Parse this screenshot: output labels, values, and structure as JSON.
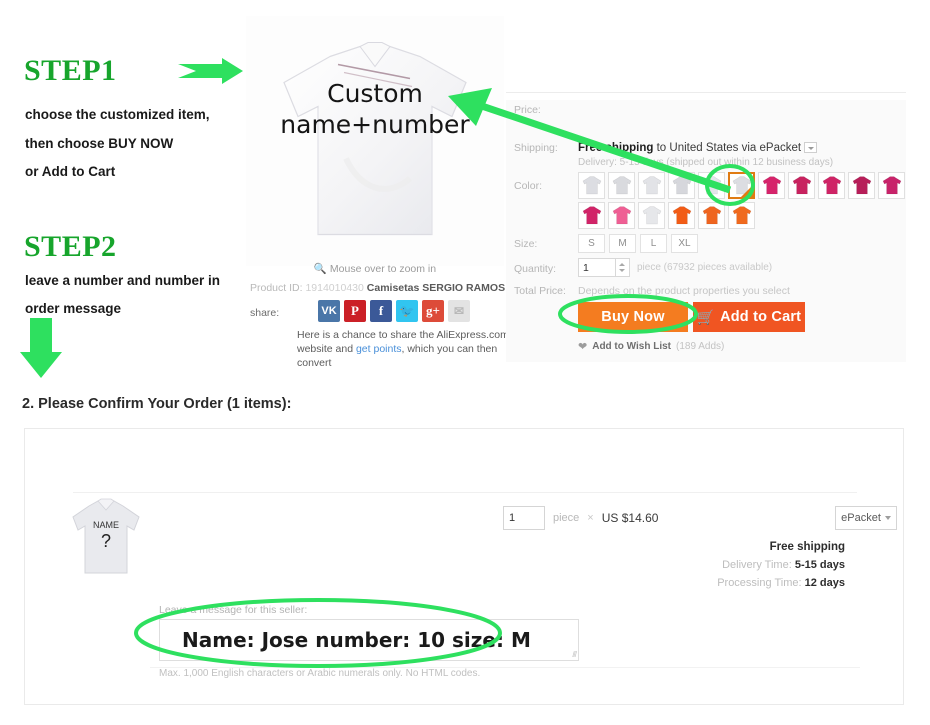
{
  "instructions": {
    "step1": {
      "title": "STEP1",
      "lines": [
        "choose the customized item,",
        "then choose BUY NOW",
        "or Add to Cart"
      ]
    },
    "step2": {
      "title": "STEP2",
      "lines": [
        "leave a number and number in",
        "order message"
      ]
    }
  },
  "product_image": {
    "overlay_line1": "Custom",
    "overlay_line2": "name+number",
    "zoom_hint": "Mouse over to zoom in",
    "zoom_icon": "search-icon"
  },
  "product_meta": {
    "id_label": "Product ID:",
    "id_value": "1914010430",
    "title": "Camisetas SERGIO RAMOS Soccer ...",
    "share_label": "share:",
    "share_icons": [
      {
        "name": "vk-icon",
        "glyph": "VK",
        "color": "#4a76a8"
      },
      {
        "name": "pinterest-icon",
        "glyph": "P",
        "color": "#cb2027"
      },
      {
        "name": "facebook-icon",
        "glyph": "f",
        "color": "#3b5998"
      },
      {
        "name": "twitter-icon",
        "glyph": "✉",
        "color": "#31c5f0"
      },
      {
        "name": "google-plus-icon",
        "glyph": "g+",
        "color": "#dd4b39"
      },
      {
        "name": "email-icon",
        "glyph": "✉",
        "color": "#e3e3e3"
      }
    ],
    "share_desc_a": "Here is a chance to share the AliExpress.com",
    "share_desc_b1": "website and ",
    "share_desc_link": "get points",
    "share_desc_b2": ", which you can then convert"
  },
  "detail": {
    "price_label": "Price:",
    "shipping_label": "Shipping:",
    "shipping_free": "Free shipping",
    "shipping_rest": " to United States via ePacket",
    "shipping_sub": "Delivery: 5-15 days (shipped out within 12 business days)",
    "color_label": "Color:",
    "colors": [
      {
        "name": "white-11",
        "hex": "#dcdde2",
        "selected": false
      },
      {
        "name": "white-10",
        "hex": "#d9dade",
        "selected": false
      },
      {
        "name": "white-7",
        "hex": "#e2e3e7",
        "selected": false
      },
      {
        "name": "white-8",
        "hex": "#d6d7dc",
        "selected": false
      },
      {
        "name": "white-plain",
        "hex": "#e4e5ea",
        "selected": false
      },
      {
        "name": "white-selected",
        "hex": "#dcdde2",
        "selected": true
      },
      {
        "name": "magenta-11",
        "hex": "#d6246b",
        "selected": false
      },
      {
        "name": "magenta-7",
        "hex": "#c8225f",
        "selected": false
      },
      {
        "name": "magenta-10",
        "hex": "#cf2466",
        "selected": false
      },
      {
        "name": "magenta-dark",
        "hex": "#b71e59",
        "selected": false
      },
      {
        "name": "magenta-plain",
        "hex": "#c8236a",
        "selected": false
      },
      {
        "name": "magenta-alt",
        "hex": "#d12468",
        "selected": false
      },
      {
        "name": "pink-light",
        "hex": "#ef5f94",
        "selected": false
      },
      {
        "name": "white-21",
        "hex": "#e6e7ea",
        "selected": false
      },
      {
        "name": "orange-1",
        "hex": "#f25c16",
        "selected": false
      },
      {
        "name": "orange-2",
        "hex": "#ef6520",
        "selected": false
      },
      {
        "name": "orange-3",
        "hex": "#f06a1e",
        "selected": false
      }
    ],
    "size_label": "Size:",
    "sizes": [
      "S",
      "M",
      "L",
      "XL"
    ],
    "quantity_label": "Quantity:",
    "quantity_value": "1",
    "quantity_note": "piece (67932 pieces available)",
    "total_label": "Total Price:",
    "total_note": "Depends on the product properties you select",
    "buy_now": "Buy Now",
    "add_to_cart": "Add to Cart",
    "cart_icon": "shopping-cart-icon",
    "heart_icon": "heart-icon",
    "wish_label": "Add to Wish List",
    "wish_count": "(189 Adds)"
  },
  "order": {
    "heading": "2. Please Confirm Your Order (1 items):",
    "thumb_name_text": "NAME",
    "thumb_number_text": "?",
    "quantity_value": "1",
    "piece_label": "piece",
    "times": "×",
    "price": "US $14.60",
    "shipping_method": "ePacket",
    "free_shipping": "Free shipping",
    "delivery_label": "Delivery Time:",
    "delivery_value": "5-15 days",
    "processing_label": "Processing Time:",
    "processing_value": "12 days",
    "message_label": "Leave a message for this seller:",
    "message_value": "Name: Jose number: 10 size: M",
    "message_hint": "Max. 1,000 English characters or Arabic numerals only. No HTML codes."
  },
  "annotations": {
    "accent_green": "#2ee05f",
    "highlight_orange": "#e07b13",
    "arrow_step1_name": "green-arrow-right",
    "arrow_step2_name": "green-arrow-down",
    "arrow_color_name": "green-arrow-to-product",
    "circle_color_swatch": "green-ellipse-color",
    "circle_buy_now": "green-ellipse-buy-now",
    "circle_message": "green-ellipse-message"
  }
}
